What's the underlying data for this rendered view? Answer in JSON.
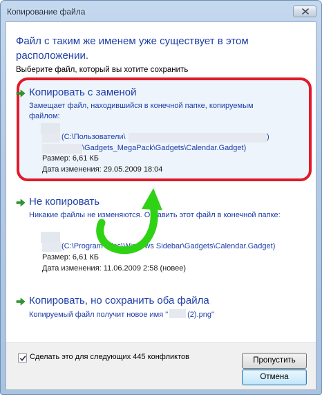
{
  "window": {
    "title": "Копирование файла"
  },
  "heading": "Файл с таким же именем уже существует в этом расположении.",
  "subheading": "Выберите файл, который вы хотите сохранить",
  "options": [
    {
      "title": "Копировать с заменой",
      "description": "Замещает файл, находившийся в конечной папке, копируемым файлом:",
      "path_line1": "(C:\\Пользователи\\",
      "path_line1_end": ")",
      "path_line2": "\\Gadgets_MegaPack\\Gadgets\\Calendar.Gadget)",
      "size": "Размер: 6,61 КБ",
      "modified": "Дата изменения: 29.05.2009 18:04"
    },
    {
      "title": "Не копировать",
      "description": "Никакие файлы не изменяются. Оставить этот файл в конечной папке:",
      "path_line1": "(C:\\Program Files\\Windows Sidebar\\Gadgets\\Calendar.Gadget)",
      "size": "Размер: 6,61 КБ",
      "modified": "Дата изменения: 11.06.2009 2:58 (новее)"
    },
    {
      "title": "Копировать, но сохранить оба файла",
      "description_prefix": "Копируемый файл получит новое имя \"",
      "description_suffix": "(2).png\""
    }
  ],
  "footer": {
    "checkbox_label": "Сделать это для следующих 445 конфликтов",
    "checkbox_checked": true,
    "skip_label": "Пропустить",
    "cancel_label": "Отмена"
  },
  "icons": {
    "option_arrow": "green-right-arrow-icon",
    "close": "close-x-icon",
    "annotation": "green-curved-arrow-icon"
  },
  "colors": {
    "link_blue": "#1e3ea8",
    "highlight_red": "#e11a2a",
    "annotation_green": "#2fd215"
  }
}
